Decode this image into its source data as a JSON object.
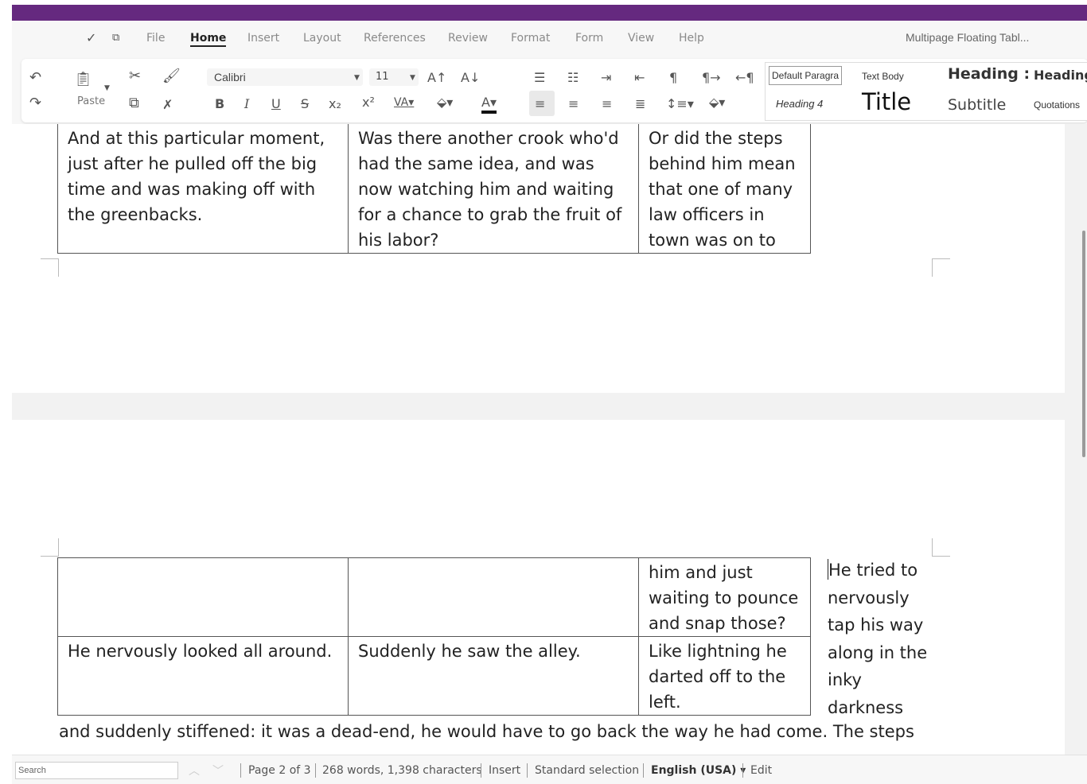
{
  "titlebar": {
    "accent": "#65297f"
  },
  "menubar": {
    "items": [
      "File",
      "Home",
      "Insert",
      "Layout",
      "References",
      "Review",
      "Format",
      "Form",
      "View",
      "Help"
    ],
    "active": "Home",
    "doc_title": "Multipage Floating Tabl..."
  },
  "ribbon": {
    "paste_label": "Paste",
    "font_name": "Calibri",
    "font_size": "11",
    "styles": [
      "Default Paragra",
      "Text Body",
      "Heading :",
      "Heading :",
      "Heading 4",
      "Title",
      "Subtitle",
      "Quotations"
    ]
  },
  "document": {
    "table1": {
      "rows": [
        [
          "And at this particular moment, just after he pulled off the big time and was making off with the greenbacks.",
          "Was there another crook who'd had the same idea, and was now watching him and waiting for a chance to grab the fruit of his labor?",
          "Or did the steps behind him mean that one of many law officers in town was on to"
        ]
      ]
    },
    "table2": {
      "rows": [
        [
          "",
          "",
          "him and just waiting to pounce and snap those?"
        ],
        [
          "He nervously looked all around.",
          "Suddenly he saw the alley.",
          "Like lightning he darted off to the left."
        ]
      ]
    },
    "float_text": "He tried to nervously tap his way along in the inky darkness",
    "body_line": "and suddenly stiffened: it was a dead-end, he would have to go back the way he had come. The steps"
  },
  "statusbar": {
    "search_placeholder": "Search",
    "page": "Page 2 of 3",
    "words": "268 words, 1,398 characters",
    "mode": "Insert",
    "selection": "Standard selection",
    "language": "English (USA)",
    "edit": "Edit"
  }
}
